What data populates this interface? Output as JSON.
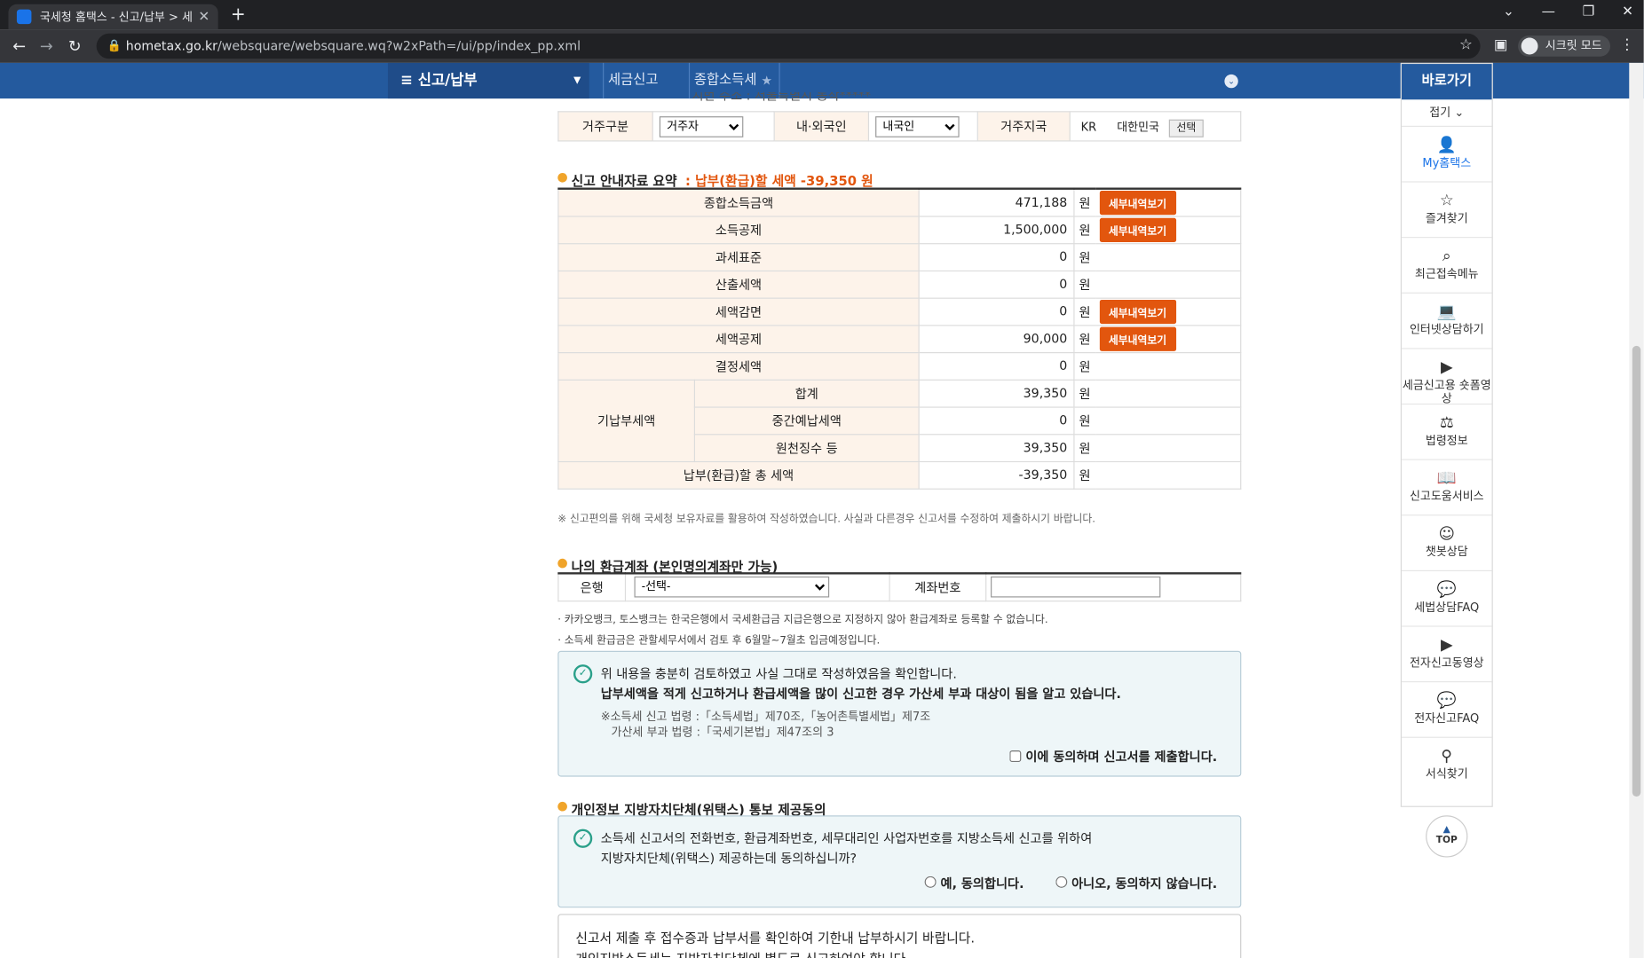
{
  "browser": {
    "tab_title": "국세청 홈택스 - 신고/납부 > 세",
    "url_host": "hometax.go.kr",
    "url_path": "/websquare/websquare.wq?w2xPath=/ui/pp/index_pp.xml",
    "incognito": "시크릿 모드"
  },
  "gnb": {
    "menu": "신고/납부",
    "crumb1": "세금신고",
    "crumb2": "종합소득세"
  },
  "residence": {
    "partial_text": "지번 주소 : 서울특별시 동작*****",
    "l1": "거주구분",
    "v1": "거주자",
    "l2": "내·외국인",
    "v2": "내국인",
    "l3": "거주지국",
    "code": "KR",
    "country": "대한민국",
    "btn": "선택"
  },
  "summary": {
    "title": "신고 안내자료 요약",
    "tax": ": 납부(환급)할 세액 -39,350 원",
    "unit": "원",
    "btn": "세부내역보기",
    "r1": {
      "label": "종합소득금액",
      "value": "471,188"
    },
    "r2": {
      "label": "소득공제",
      "value": "1,500,000"
    },
    "r3": {
      "label": "과세표준",
      "value": "0"
    },
    "r4": {
      "label": "산출세액",
      "value": "0"
    },
    "r5": {
      "label": "세액감면",
      "value": "0"
    },
    "r6": {
      "label": "세액공제",
      "value": "90,000"
    },
    "r7": {
      "label": "결정세액",
      "value": "0"
    },
    "prepaid": "기납부세액",
    "p1": {
      "label": "합계",
      "value": "39,350"
    },
    "p2": {
      "label": "중간예납세액",
      "value": "0"
    },
    "p3": {
      "label": "원천징수 등",
      "value": "39,350"
    },
    "total": {
      "label": "납부(환급)할 총 세액",
      "value": "-39,350"
    },
    "note": "※ 신고편의를 위해 국세청 보유자료를 활용하여 작성하였습니다. 사실과 다른경우 신고서를 수정하여 제출하시기 바랍니다."
  },
  "refund": {
    "title": "나의 환급계좌 (본인명의계좌만 가능)",
    "bank": "은행",
    "bank_sel": "-선택-",
    "acct": "계좌번호",
    "n1": "· 카카오뱅크, 토스뱅크는 한국은행에서 국세환급금 지급은행으로 지정하지 않아 환급계좌로 등록할 수 없습니다.",
    "n2": "· 소득세 환급금은 관할세무서에서 검토 후 6월말~7월초 입금예정입니다."
  },
  "confirm": {
    "l1": "위 내용을 충분히 검토하였고 사실 그대로 작성하였음을 확인합니다.",
    "l2": "납부세액을 적게 신고하거나 환급세액을 많이 신고한 경우 가산세 부과 대상이 됨을 알고 있습니다.",
    "law1": "※소득세 신고 법령 :「소득세법」제70조,「농어촌특별세법」제7조",
    "law2": "가산세 부과 법령 :「국세기본법」제47조의 3",
    "agree": "이에 동의하며 신고서를 제출합니다."
  },
  "privacy": {
    "title": "개인정보 지방자치단체(위택스) 통보 제공동의",
    "l1": "소득세 신고서의 전화번호, 환급계좌번호, 세무대리인 사업자번호를 지방소득세 신고를 위하여",
    "l2": "지방자치단체(위택스) 제공하는데 동의하십니까?",
    "yes": "예, 동의합니다.",
    "no": "아니오, 동의하지 않습니다."
  },
  "final": {
    "l1": "신고서 제출 후 접수증과 납부서를 확인하여 기한내 납부하시기 바랍니다.",
    "l2": "개인지방소득세는 지방자치단체에 별도로 신고하여야 합니다."
  },
  "quick": {
    "head": "바로가기",
    "fold": "접기",
    "items": [
      "My홈택스",
      "즐겨찾기",
      "최근접속메뉴",
      "인터넷상담하기",
      "세금신고용 숏폼영상",
      "법령정보",
      "신고도움서비스",
      "챗봇상담",
      "세법상담FAQ",
      "전자신고동영상",
      "전자신고FAQ",
      "서식찾기"
    ],
    "top": "TOP"
  }
}
